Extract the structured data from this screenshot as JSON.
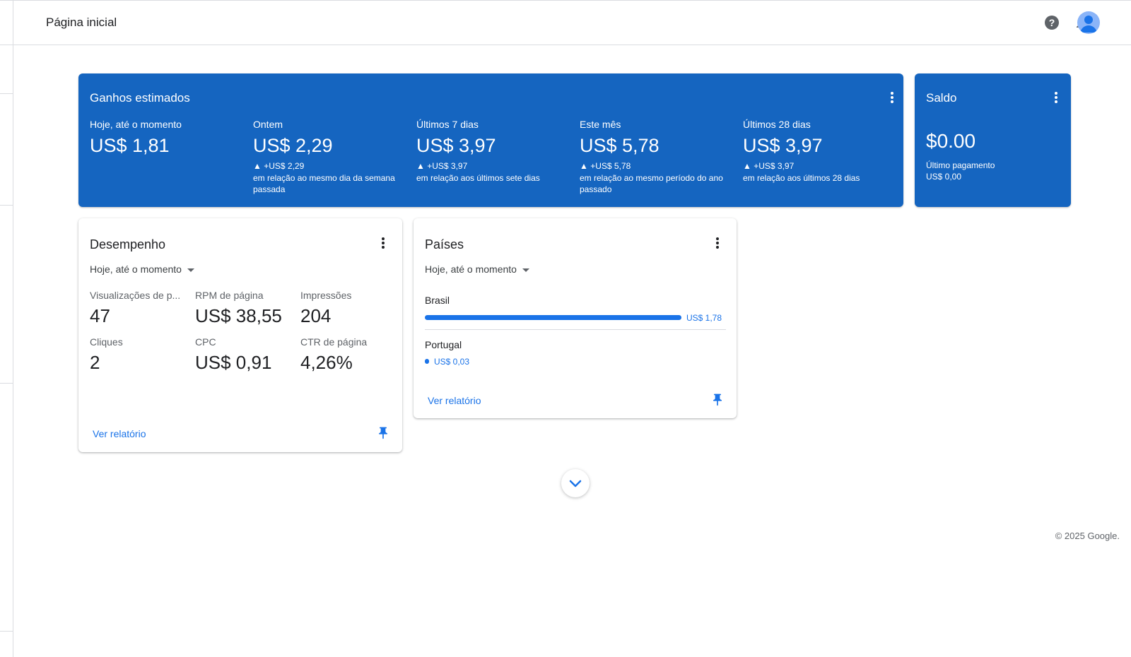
{
  "header": {
    "title": "Página inicial"
  },
  "earnings": {
    "title": "Ganhos estimados",
    "metrics": [
      {
        "label": "Hoje, até o momento",
        "value": "US$ 1,81"
      },
      {
        "label": "Ontem",
        "value": "US$ 2,29",
        "delta": "▲ +US$ 2,29",
        "desc": "em relação ao mesmo dia da semana passada"
      },
      {
        "label": "Últimos 7 dias",
        "value": "US$ 3,97",
        "delta": "▲ +US$ 3,97",
        "desc": "em relação aos últimos sete dias"
      },
      {
        "label": "Este mês",
        "value": "US$ 5,78",
        "delta": "▲ +US$ 5,78",
        "desc": "em relação ao mesmo período do ano passado"
      },
      {
        "label": "Últimos 28 dias",
        "value": "US$ 3,97",
        "delta": "▲ +US$ 3,97",
        "desc": "em relação aos últimos 28 dias"
      }
    ]
  },
  "balance": {
    "title": "Saldo",
    "value": "$0.00",
    "last_payment_label": "Último pagamento",
    "last_payment_value": "US$ 0,00"
  },
  "performance": {
    "title": "Desempenho",
    "period": "Hoje, até o momento",
    "stats": [
      {
        "label": "Visualizações de p...",
        "value": "47"
      },
      {
        "label": "RPM de página",
        "value": "US$ 38,55"
      },
      {
        "label": "Impressões",
        "value": "204"
      },
      {
        "label": "Cliques",
        "value": "2"
      },
      {
        "label": "CPC",
        "value": "US$ 0,91"
      },
      {
        "label": "CTR de página",
        "value": "4,26%"
      }
    ],
    "link": "Ver relatório"
  },
  "countries": {
    "title": "Países",
    "period": "Hoje, até o momento",
    "items": [
      {
        "name": "Brasil",
        "value": "US$ 1,78",
        "share": 1.0
      },
      {
        "name": "Portugal",
        "value": "US$ 0,03",
        "share": 0.017
      }
    ],
    "link": "Ver relatório"
  },
  "footer": {
    "copyright": "© 2025 Google."
  },
  "colors": {
    "primary": "#1565c0",
    "accent": "#1a73e8",
    "avatar": "#8ab4f8",
    "icon": "#5f6368"
  },
  "icons": [
    "help-icon",
    "bell-icon",
    "avatar-icon",
    "more-vert-icon",
    "pin-icon",
    "chevron-down-icon",
    "caret-down-icon"
  ]
}
